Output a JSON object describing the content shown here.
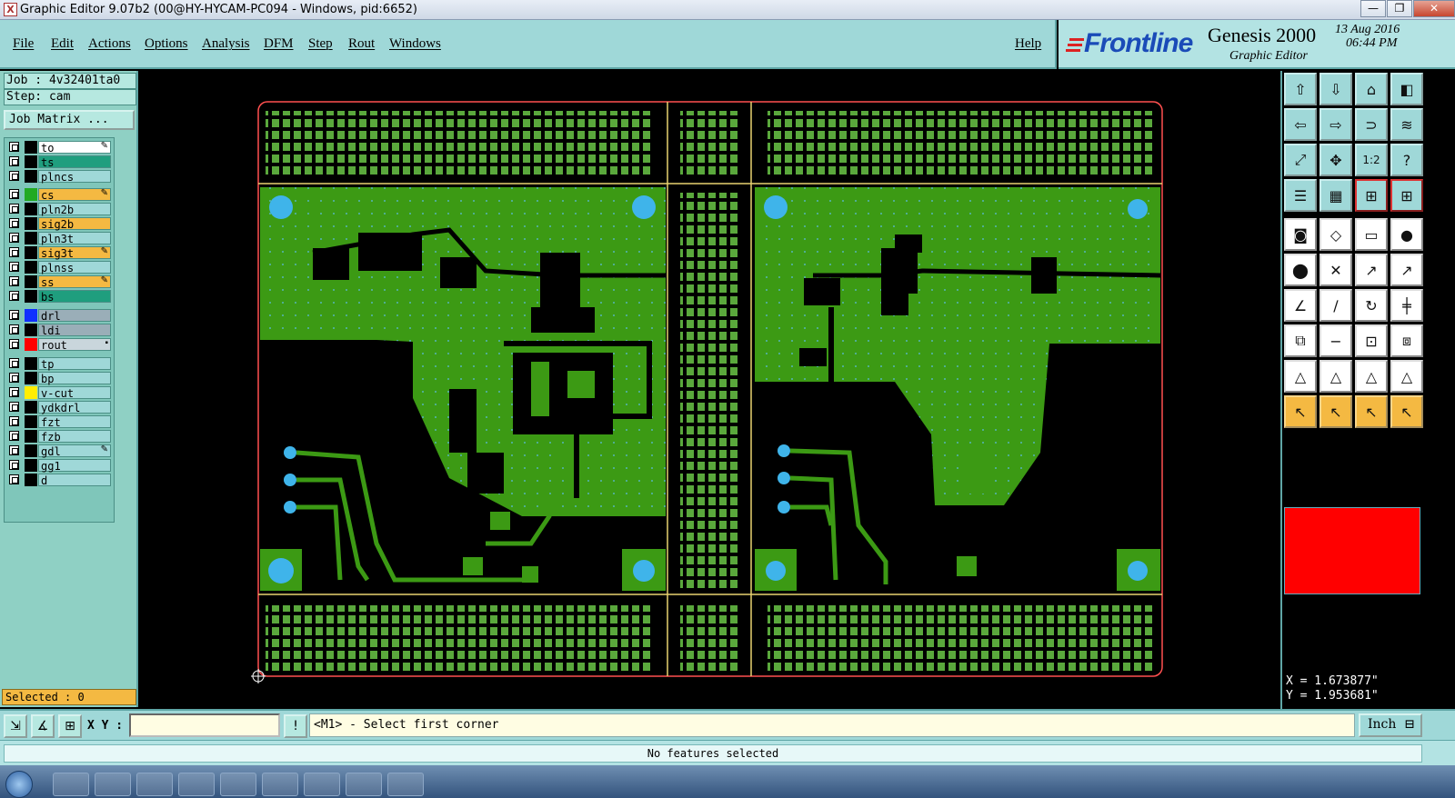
{
  "window": {
    "title": "Graphic Editor 9.07b2 (00@HY-HYCAM-PC094 - Windows, pid:6652)",
    "minimize": "—",
    "maximize": "❐",
    "close": "✕"
  },
  "menu": {
    "items": [
      "File",
      "Edit",
      "Actions",
      "Options",
      "Analysis",
      "DFM",
      "Step",
      "Rout",
      "Windows"
    ],
    "help": "Help"
  },
  "brand": {
    "logo": "Frontline",
    "product": "Genesis 2000",
    "subtitle": "Graphic Editor",
    "date": "13 Aug 2016",
    "time": "06:44 PM"
  },
  "job": {
    "job_label": "Job : 4v32401ta0",
    "step_label": "Step: cam",
    "matrix_button": "Job Matrix ..."
  },
  "layers": [
    {
      "name": "to",
      "bg": "#ffffff",
      "swatch": "#000000",
      "mark": "✎"
    },
    {
      "name": "ts",
      "bg": "#1f9e7e",
      "swatch": "#000000",
      "mark": ""
    },
    {
      "name": "plncs",
      "bg": "#9fd8d8",
      "swatch": "#000000",
      "mark": ""
    },
    {
      "name": "cs",
      "bg": "#f4b942",
      "swatch": "#22aa22",
      "mark": "✎"
    },
    {
      "name": "pln2b",
      "bg": "#9fd8d8",
      "swatch": "#000000",
      "mark": ""
    },
    {
      "name": "sig2b",
      "bg": "#f4b942",
      "swatch": "#000000",
      "mark": ""
    },
    {
      "name": "pln3t",
      "bg": "#9fd8d8",
      "swatch": "#000000",
      "mark": ""
    },
    {
      "name": "sig3t",
      "bg": "#f4b942",
      "swatch": "#000000",
      "mark": "✎"
    },
    {
      "name": "plnss",
      "bg": "#9fd8d8",
      "swatch": "#000000",
      "mark": ""
    },
    {
      "name": "ss",
      "bg": "#f4b942",
      "swatch": "#000000",
      "mark": "✎"
    },
    {
      "name": "bs",
      "bg": "#1f9e7e",
      "swatch": "#000000",
      "mark": ""
    },
    {
      "name": "drl",
      "bg": "#9aaeb8",
      "swatch": "#1030ff",
      "mark": ""
    },
    {
      "name": "ldi",
      "bg": "#9aaeb8",
      "swatch": "#000000",
      "mark": ""
    },
    {
      "name": "rout",
      "bg": "#c9d6dc",
      "swatch": "#ff0000",
      "mark": "▪"
    },
    {
      "name": "tp",
      "bg": "#9fd8d8",
      "swatch": "#000000",
      "mark": ""
    },
    {
      "name": "bp",
      "bg": "#9fd8d8",
      "swatch": "#000000",
      "mark": ""
    },
    {
      "name": "v-cut",
      "bg": "#9fd8d8",
      "swatch": "#ffee00",
      "mark": ""
    },
    {
      "name": "ydkdrl",
      "bg": "#9fd8d8",
      "swatch": "#000000",
      "mark": ""
    },
    {
      "name": "fzt",
      "bg": "#9fd8d8",
      "swatch": "#000000",
      "mark": ""
    },
    {
      "name": "fzb",
      "bg": "#9fd8d8",
      "swatch": "#000000",
      "mark": ""
    },
    {
      "name": "gdl",
      "bg": "#9fd8d8",
      "swatch": "#000000",
      "mark": "✎"
    },
    {
      "name": "gg1",
      "bg": "#9fd8d8",
      "swatch": "#000000",
      "mark": ""
    },
    {
      "name": "d",
      "bg": "#9fd8d8",
      "swatch": "#000000",
      "mark": ""
    }
  ],
  "selection": {
    "label": "Selected : 0"
  },
  "tools": {
    "row_glyphs": [
      "⇧",
      "⇩",
      "⌂",
      "◧",
      "⇦",
      "⇨",
      "⊃",
      "≋",
      "⤢",
      "✥",
      "1:2",
      "?",
      "☰",
      "▦",
      "⊞",
      "⊞",
      "◙",
      "◇",
      "▭",
      "●",
      "⬤",
      "✕",
      "↗",
      "↗",
      "∠",
      "∕",
      "↻",
      "╪",
      "⧉",
      "−",
      "⊡",
      "⧈",
      "△",
      "△",
      "△",
      "△",
      "↖",
      "↖",
      "↖",
      "↖"
    ]
  },
  "coords": {
    "x": "X = 1.673877\"",
    "y": "Y = 1.953681\""
  },
  "command": {
    "xy_label": "X Y :",
    "xy_value": "",
    "prompt": "<M1> - Select first corner",
    "alert_button": "!",
    "unit": "Inch"
  },
  "status": {
    "text": "No features selected"
  },
  "colors": {
    "copper": "#3c9a14",
    "pad": "#5aa83c",
    "hole": "#3fb4ea",
    "outline": "#e8d270",
    "rout": "#ff5050"
  }
}
